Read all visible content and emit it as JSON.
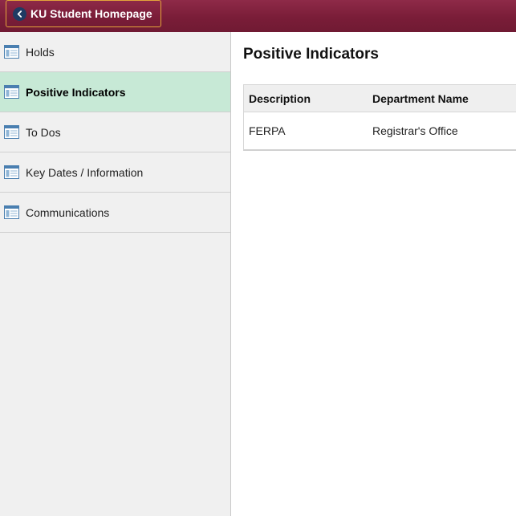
{
  "header": {
    "back_label": "KU Student Homepage",
    "back_icon": "chevron-left-icon",
    "brand_color": "#7a1d38",
    "back_border_color": "#e3a53a"
  },
  "sidebar": {
    "items": [
      {
        "label": "Holds",
        "icon": "list-window-icon",
        "selected": false
      },
      {
        "label": "Positive Indicators",
        "icon": "list-window-icon",
        "selected": true
      },
      {
        "label": "To Dos",
        "icon": "list-window-icon",
        "selected": false
      },
      {
        "label": "Key Dates / Information",
        "icon": "list-window-icon",
        "selected": false
      },
      {
        "label": "Communications",
        "icon": "list-window-icon",
        "selected": false
      }
    ],
    "selected_color": "#c7e9d6"
  },
  "main": {
    "title": "Positive Indicators",
    "table": {
      "columns": [
        "Description",
        "Department Name"
      ],
      "rows": [
        [
          "FERPA",
          "Registrar's Office"
        ]
      ]
    }
  }
}
